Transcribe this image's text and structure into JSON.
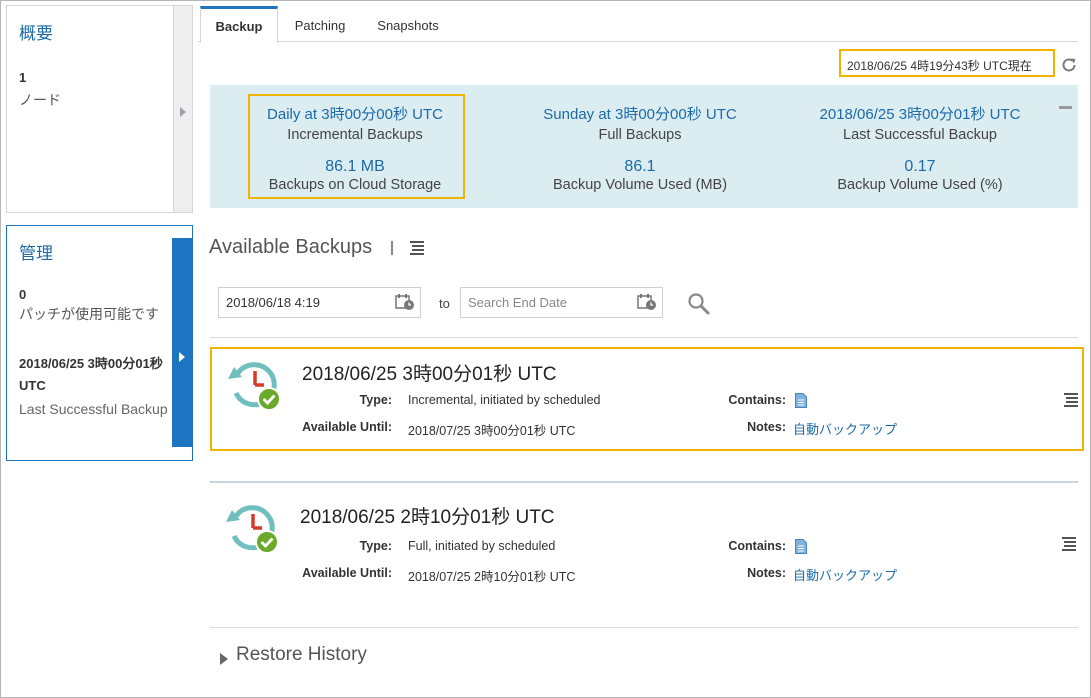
{
  "overview": {
    "title": "概要",
    "count": "1",
    "unit": "ノード"
  },
  "management": {
    "title": "管理",
    "count": "0",
    "subtitle": "パッチが使用可能です",
    "last_backup_date": "2018/06/25 3時00分01秒 UTC",
    "last_backup_label": "Last Successful Backup"
  },
  "tabs": [
    {
      "label": "Backup",
      "active": true
    },
    {
      "label": "Patching",
      "active": false
    },
    {
      "label": "Snapshots",
      "active": false
    }
  ],
  "current_time": "2018/06/25 4時19分43秒 UTC現在",
  "summary": {
    "schedules": [
      {
        "value": "Daily at 3時00分00秒 UTC",
        "label": "Incremental Backups"
      },
      {
        "value": "Sunday at 3時00分00秒 UTC",
        "label": "Full Backups"
      },
      {
        "value": "2018/06/25 3時00分01秒 UTC",
        "label": "Last Successful Backup"
      }
    ],
    "metrics": [
      {
        "value": "86.1 MB",
        "label": "Backups on Cloud Storage"
      },
      {
        "value": "86.1",
        "label": "Backup Volume Used (MB)"
      },
      {
        "value": "0.17",
        "label": "Backup Volume Used (%)"
      }
    ]
  },
  "available": {
    "title": "Available Backups",
    "start_date_value": "2018/06/18 4:19",
    "to_label": "to",
    "end_date_placeholder": "Search End Date"
  },
  "backups": [
    {
      "title": "2018/06/25 3時00分01秒 UTC",
      "type_label": "Type:",
      "type": "Incremental, initiated by scheduled",
      "until_label": "Available Until:",
      "until": "2018/07/25 3時00分01秒 UTC",
      "contains_label": "Contains:",
      "notes_label": "Notes:",
      "notes": "自動バックアップ"
    },
    {
      "title": "2018/06/25 2時10分01秒 UTC",
      "type_label": "Type:",
      "type": "Full, initiated by scheduled",
      "until_label": "Available Until:",
      "until": "2018/07/25 2時10分01秒 UTC",
      "contains_label": "Contains:",
      "notes_label": "Notes:",
      "notes": "自動バックアップ"
    }
  ],
  "restore_history": "Restore History",
  "colors": {
    "accent": "#1d75c2",
    "link": "#1c6aa8",
    "highlight": "#f0b400",
    "summary_bg": "#dcedf2",
    "success": "#6aa92a",
    "clock_teal": "#6fbfbf",
    "clock_red": "#d9392b"
  }
}
